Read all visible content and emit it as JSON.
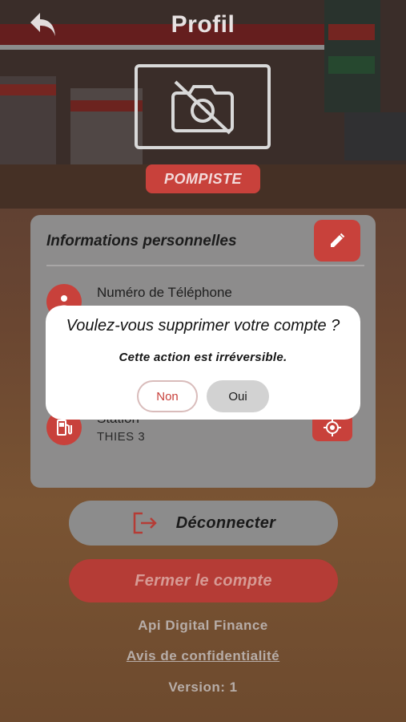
{
  "header": {
    "title": "Profil",
    "back_icon": "back-arrow-icon"
  },
  "profile": {
    "photo_icon": "camera-off-icon",
    "role": "POMPISTE"
  },
  "card": {
    "title": "Informations personnelles",
    "edit_icon": "pencil-icon",
    "fields": [
      {
        "label": "Numéro de Téléphone",
        "value": "",
        "icon": "person-icon"
      },
      {
        "label": "Station",
        "value": "THIES 3",
        "icon": "fuel-pump-icon",
        "action_icon": "locate-icon"
      }
    ]
  },
  "actions": {
    "logout_label": "Déconnecter",
    "logout_icon": "logout-icon",
    "close_account_label": "Fermer le compte"
  },
  "footer": {
    "company": "Api Digital Finance",
    "privacy_link": "Avis de confidentialité",
    "version": "Version: 1"
  },
  "dialog": {
    "title": "Voulez-vous supprimer votre compte ?",
    "message": "Cette action est irréversible.",
    "no_label": "Non",
    "yes_label": "Oui"
  },
  "colors": {
    "accent": "#c8413b",
    "card": "#8d8c8c",
    "dialog": "#ffffff"
  }
}
